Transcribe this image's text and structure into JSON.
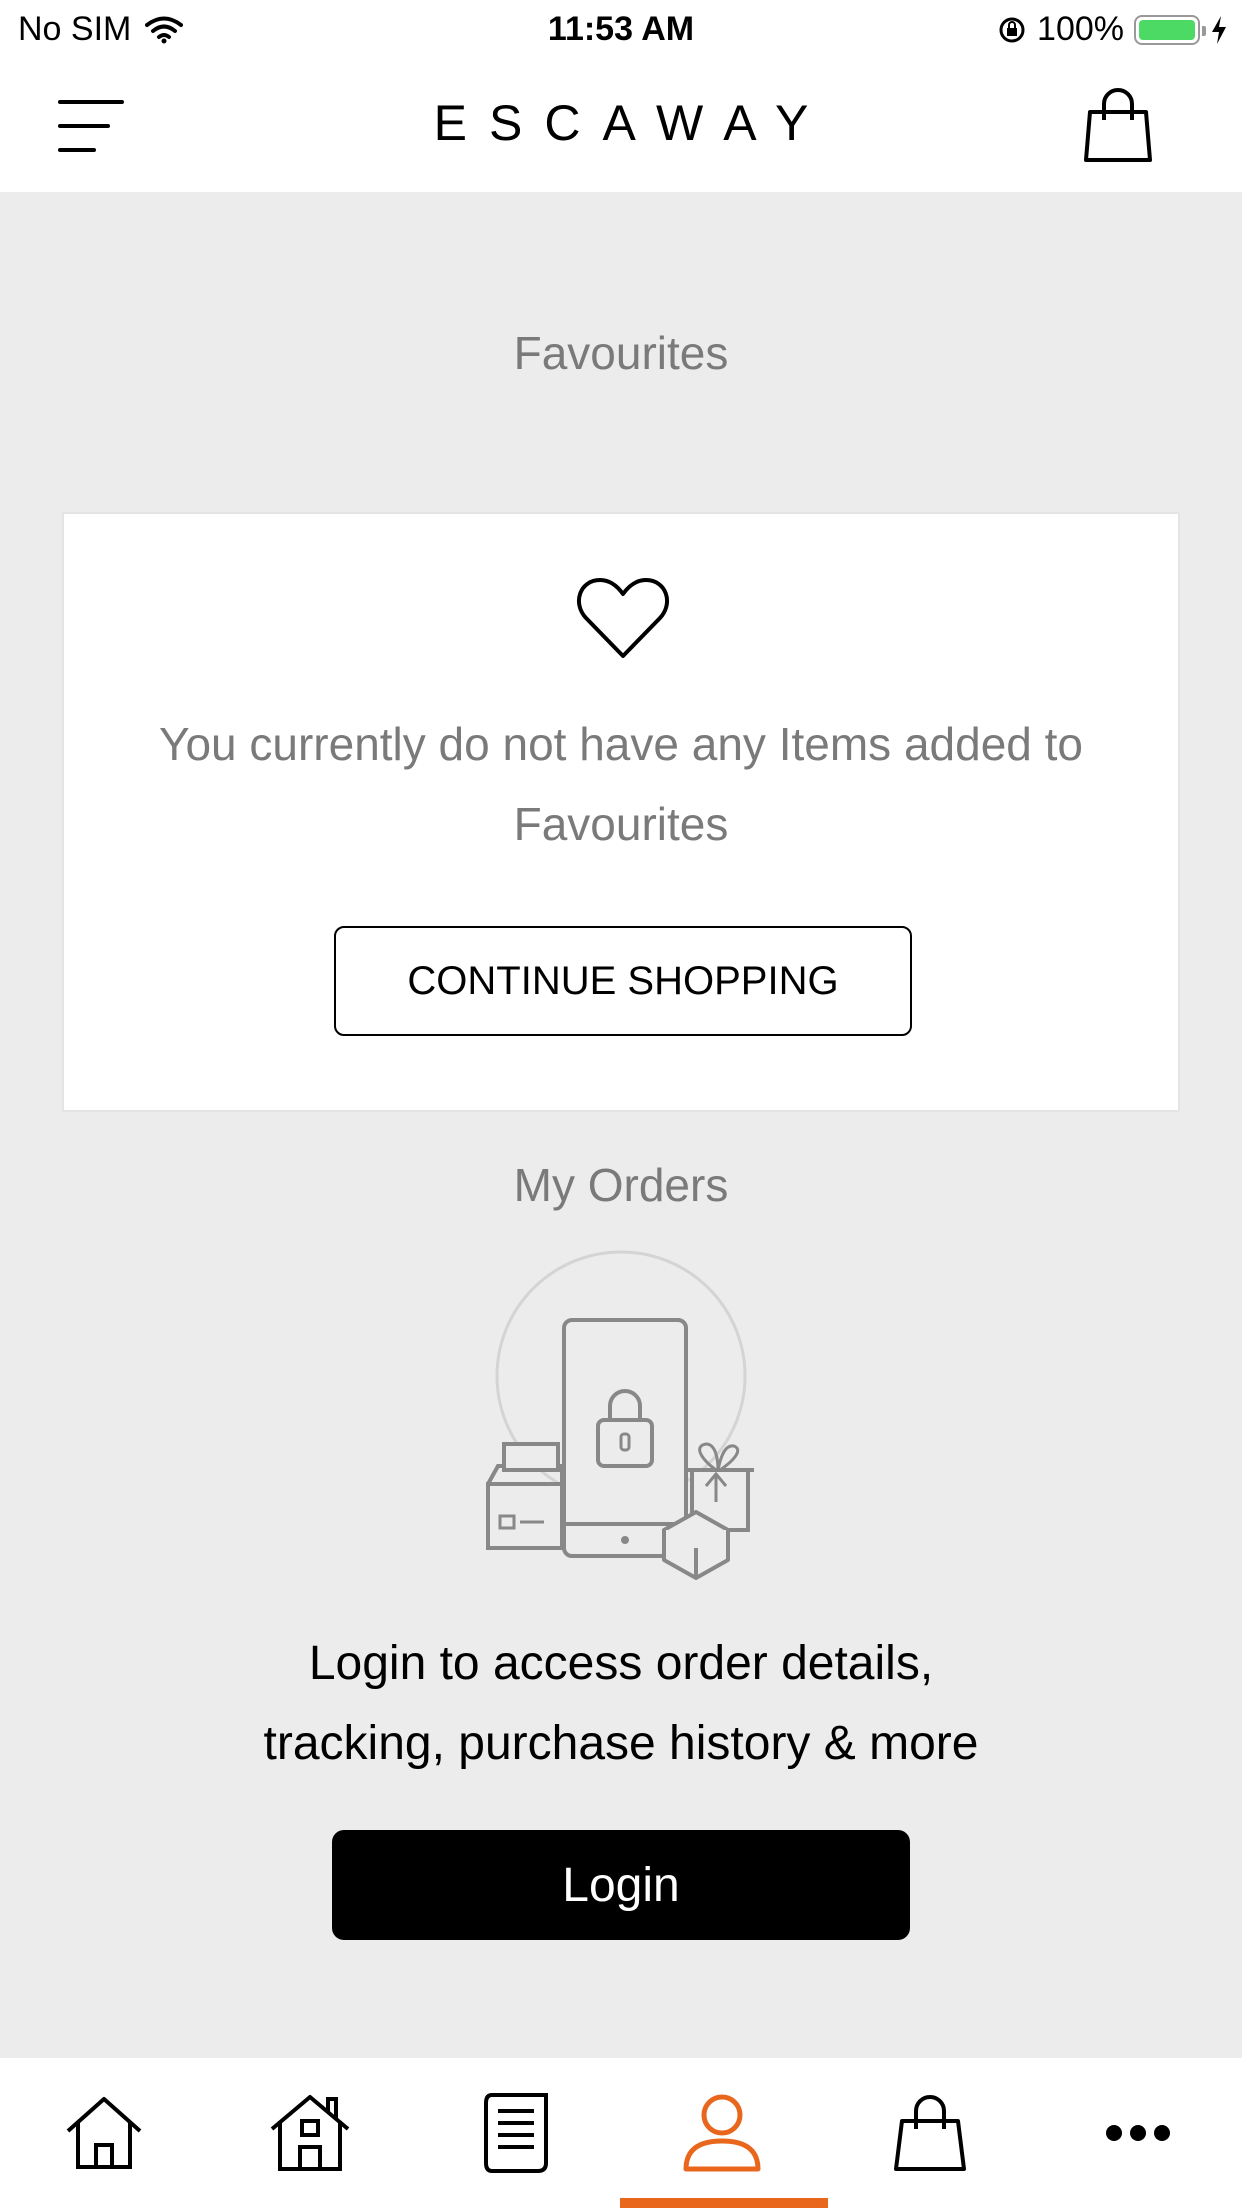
{
  "status_bar": {
    "carrier": "No SIM",
    "time": "11:53 AM",
    "battery": "100%",
    "battery_level": 1.0
  },
  "header": {
    "brand": "ESCAWAY",
    "menu_icon": "hamburger-menu-icon",
    "cart_icon": "shopping-bag-icon"
  },
  "favourites": {
    "title": "Favourites",
    "icon": "heart-icon",
    "message": "You currently do not have any Items added to Favourites",
    "button_label": "CONTINUE SHOPPING"
  },
  "orders": {
    "title": "My Orders",
    "illustration": "locked-phone-with-packages-illustration",
    "message": "Login to access order details, tracking, purchase history & more",
    "button_label": "Login"
  },
  "tab_bar": {
    "items": [
      {
        "icon": "home-icon"
      },
      {
        "icon": "store-icon"
      },
      {
        "icon": "document-icon"
      },
      {
        "icon": "account-icon",
        "active": true
      },
      {
        "icon": "shopping-bag-icon"
      },
      {
        "icon": "more-icon"
      }
    ],
    "active_color": "#e8671c"
  },
  "colors": {
    "background": "#ececec",
    "muted_text": "#7a7a7a",
    "accent": "#e8671c"
  }
}
